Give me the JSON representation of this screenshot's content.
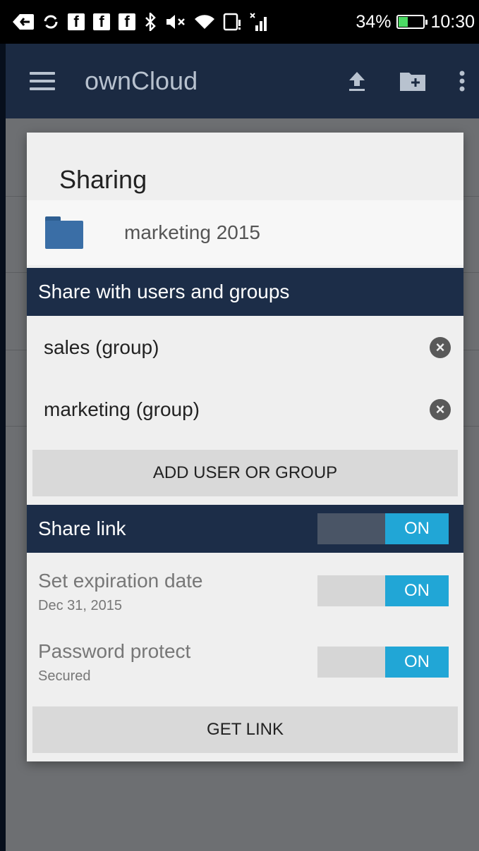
{
  "status_bar": {
    "battery": "34%",
    "time": "10:30",
    "icons": [
      "back-icon",
      "sync-icon",
      "facebook-icon",
      "facebook-icon",
      "facebook-icon",
      "bluetooth-icon",
      "volume-muted-icon",
      "wifi-icon",
      "storage-alert-icon",
      "signal-icon",
      "battery-icon"
    ]
  },
  "app_bar": {
    "title": "ownCloud",
    "actions": [
      "upload-icon",
      "new-folder-icon",
      "more-vert-icon"
    ]
  },
  "dialog": {
    "title": "Sharing",
    "file": {
      "name": "marketing 2015",
      "icon": "folder-icon"
    },
    "share_with": {
      "header": "Share with users and groups",
      "users": [
        {
          "name": "sales (group)"
        },
        {
          "name": "marketing (group)"
        }
      ],
      "add_button": "ADD USER OR GROUP"
    },
    "share_link": {
      "header": "Share link",
      "toggle": "ON",
      "expiration": {
        "label": "Set expiration date",
        "value": "Dec 31, 2015",
        "toggle": "ON"
      },
      "password": {
        "label": "Password protect",
        "value": "Secured",
        "toggle": "ON"
      },
      "get_link_button": "GET LINK"
    }
  },
  "colors": {
    "app_bar": "#1b2a42",
    "section_header": "#1c2d48",
    "toggle_on": "#21a6d6",
    "dialog_bg": "#efefef"
  }
}
